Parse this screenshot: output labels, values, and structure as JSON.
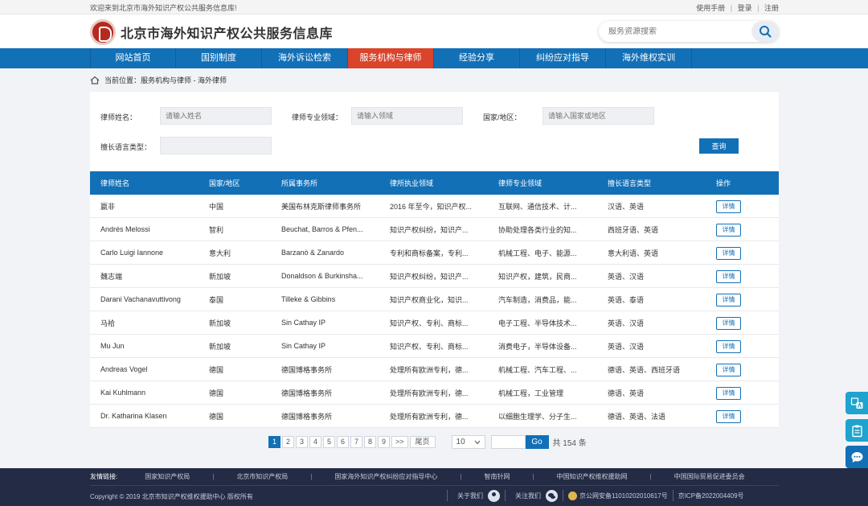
{
  "topbar": {
    "welcome": "欢迎来到北京市海外知识产权公共服务信息库!",
    "manual": "使用手册",
    "sep": "|",
    "login": "登录",
    "register": "注册"
  },
  "header": {
    "site_name": "北京市海外知识产权公共服务信息库",
    "search_placeholder": "服务资源搜索"
  },
  "nav": [
    {
      "label": "网站首页"
    },
    {
      "label": "国别制度"
    },
    {
      "label": "海外诉讼检索"
    },
    {
      "label": "服务机构与律师"
    },
    {
      "label": "经验分享"
    },
    {
      "label": "纠纷应对指导"
    },
    {
      "label": "海外维权实训"
    }
  ],
  "breadcrumb": {
    "prefix": "当前位置：",
    "path": "服务机构与律师 - 海外律师"
  },
  "filters": {
    "name_label": "律师姓名：",
    "name_placeholder": "请输入姓名",
    "field_label": "律师专业领域：",
    "field_placeholder": "请输入领域",
    "country_label": "国家/地区：",
    "country_placeholder": "请输入国家或地区",
    "language_label": "擅长语言类型：",
    "language_placeholder": "",
    "query_label": "查询"
  },
  "table": {
    "headers": [
      "律师姓名",
      "国家/地区",
      "所属事务所",
      "律所执业领域",
      "律师专业领域",
      "擅长语言类型",
      "操作"
    ],
    "detail_label": "详情",
    "rows": [
      [
        "嬴非",
        "中国",
        "美国布林克斯律师事务所",
        "2016 年至今，知识产权...",
        "互联网、通信技术、计...",
        "汉语、英语"
      ],
      [
        "Andrés Melossi",
        "智利",
        "Beuchat, Barros & Pfen...",
        "知识产权纠纷，知识产...",
        "协助处理各类行业的知...",
        "西班牙语、英语"
      ],
      [
        "Carlo Luigi Iannone",
        "意大利",
        "Barzanò & Zanardo",
        "专利和商标备案，专利...",
        "机械工程、电子、能源...",
        "意大利语、英语"
      ],
      [
        "魏志端",
        "新加坡",
        "Donaldson & Burkinsha...",
        "知识产权纠纷，知识产...",
        "知识产权，建筑，民商...",
        "英语、汉语"
      ],
      [
        "Darani Vachanavuttivong",
        "泰国",
        "Tilleke & Gibbins",
        "知识产权商业化，知识...",
        "汽车制造，消费品，能...",
        "英语、泰语"
      ],
      [
        "马袷",
        "新加坡",
        "Sin Cathay IP",
        "知识产权、专利、商标...",
        "电子工程、半导体技术...",
        "英语、汉语"
      ],
      [
        "Mu Jun",
        "新加坡",
        "Sin Cathay IP",
        "知识产权、专利、商标...",
        "消费电子，半导体设备...",
        "英语、汉语"
      ],
      [
        "Andreas Vogel",
        "德国",
        "德国博格事务所",
        "处理所有欧洲专利，德...",
        "机械工程、汽车工程、...",
        "德语、英语、西班牙语"
      ],
      [
        "Kai Kuhlmann",
        "德国",
        "德国博格事务所",
        "处理所有欧洲专利，德...",
        "机械工程，工业管理",
        "德语、英语"
      ],
      [
        "Dr. Katharina Klasen",
        "德国",
        "德国博格事务所",
        "处理所有欧洲专利，德...",
        "以细胞生理学、分子生...",
        "德语、英语、法语"
      ]
    ]
  },
  "pager": {
    "pages": [
      "1",
      "2",
      "3",
      "4",
      "5",
      "6",
      "7",
      "8",
      "9"
    ],
    "current_page": "1",
    "next": ">>",
    "last": "尾页",
    "page_size": "10",
    "go": "Go",
    "total": "共 154 条"
  },
  "footer": {
    "friend_label": "友情链接:",
    "links": [
      "国家知识产权局",
      "北京市知识产权局",
      "国家海外知识产权纠纷应对指导中心",
      "智南针网",
      "中国知识产权维权援助网",
      "中国国际贸易促进委员会"
    ],
    "copyright": "Copyright © 2019 北京市知识产权维权援助中心 版权所有",
    "about": "关于我们",
    "follow": "关注我们",
    "police_record": "京公网安备11010202010617号",
    "icp": "京ICP备2022004409号"
  }
}
